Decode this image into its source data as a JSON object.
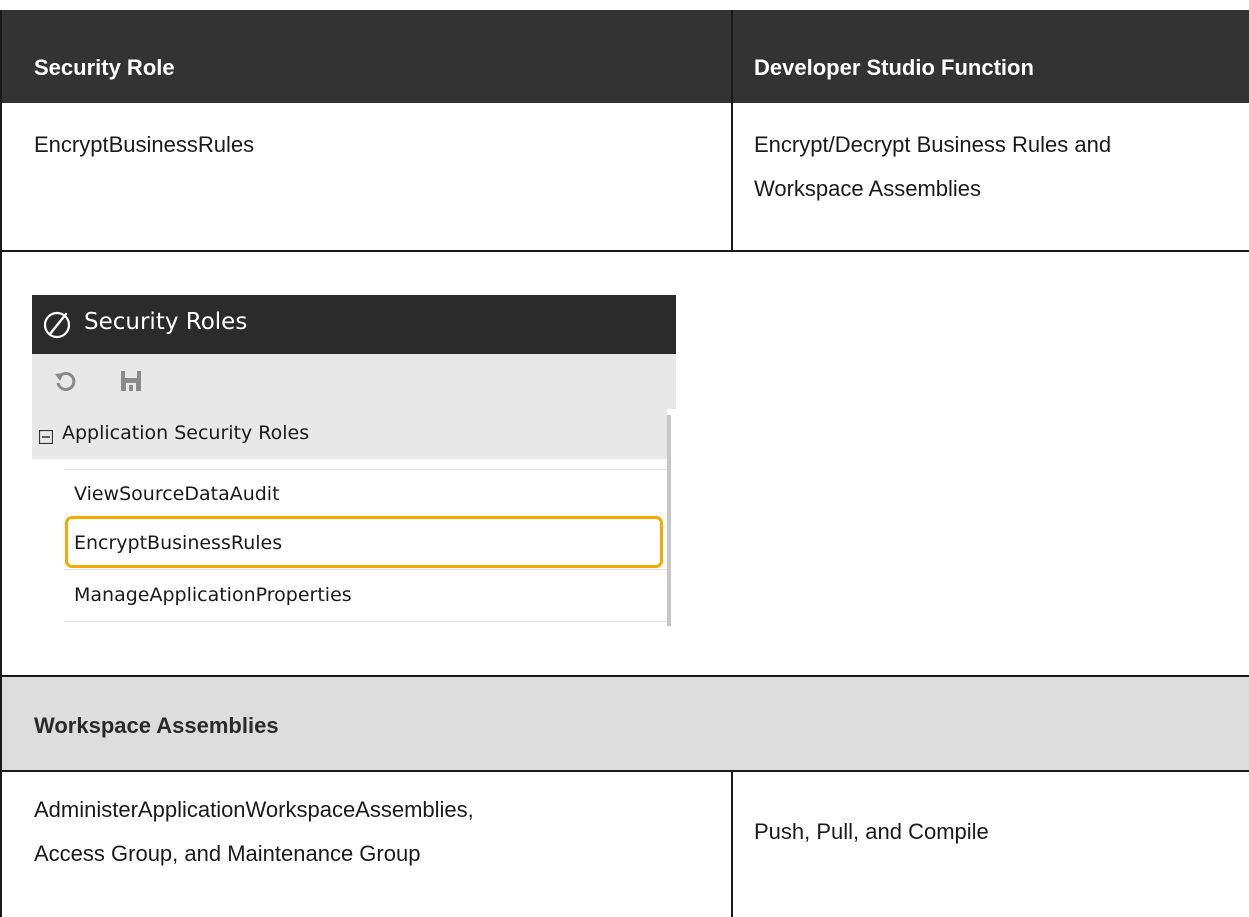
{
  "table": {
    "header": {
      "col1": "Security Role",
      "col2": "Developer Studio Function"
    },
    "row1": {
      "role": "EncryptBusinessRules",
      "function_line1": "Encrypt/Decrypt Business Rules and",
      "function_line2": "Workspace Assemblies"
    },
    "section": {
      "title": "Workspace Assemblies"
    },
    "row2": {
      "role_line1": "AdministerApplicationWorkspaceAssemblies,",
      "role_line2": "Access Group, and Maintenance Group",
      "function": "Push, Pull, and Compile"
    }
  },
  "screenshot": {
    "title": "Security Roles",
    "icons": [
      "app-logo-icon",
      "refresh-icon",
      "save-icon",
      "collapse-icon"
    ],
    "group_label": "Application Security Roles",
    "items": [
      "ViewSourceDataAudit",
      "EncryptBusinessRules",
      "ManageApplicationProperties"
    ],
    "highlighted_item": "EncryptBusinessRules",
    "colors": {
      "titlebar": "#2b2b2b",
      "toolbar": "#e8e8e8",
      "highlight": "#f5a800"
    }
  },
  "colors": {
    "header_bg": "#333333",
    "section_bg": "#dddddd",
    "border": "#1a1a1a"
  }
}
